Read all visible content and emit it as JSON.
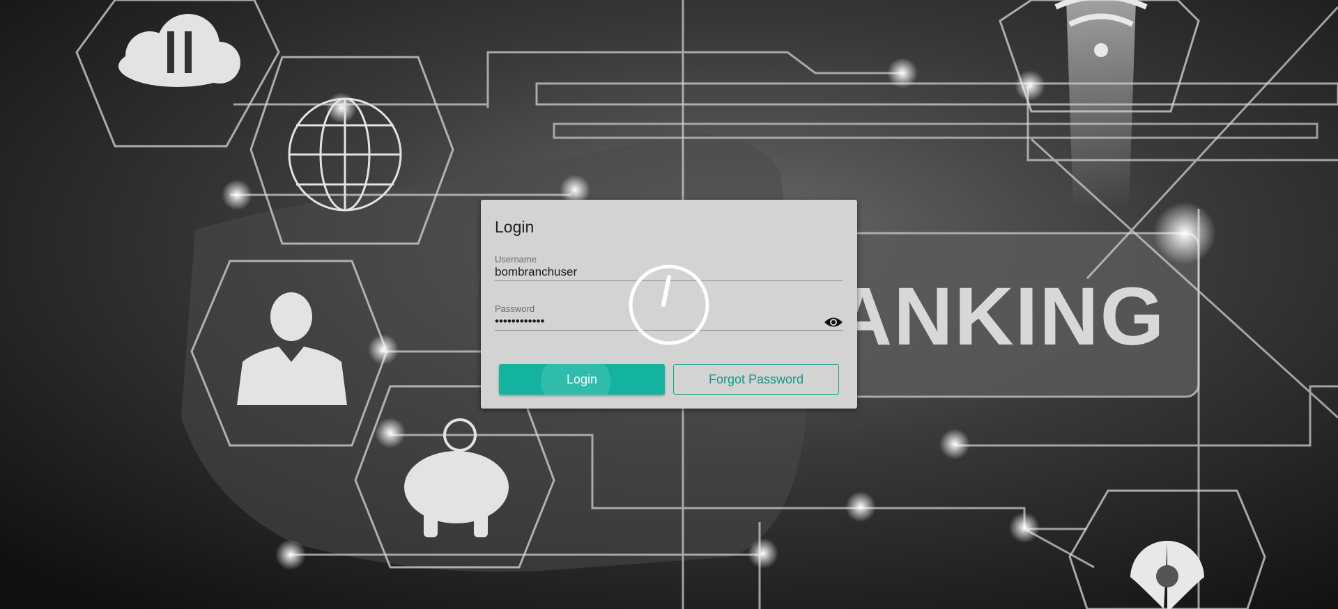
{
  "background": {
    "banner_text": "ANKING"
  },
  "login": {
    "title": "Login",
    "username_label": "Username",
    "username_value": "bombranchuser",
    "password_label": "Password",
    "password_value": "••••••••••••",
    "login_button": "Login",
    "forgot_button": "Forgot Password",
    "show_password_icon": "eye-icon"
  },
  "colors": {
    "accent": "#13b3a0",
    "card_bg": "#d3d3d3"
  },
  "loading": {
    "icon": "loading-spinner-icon"
  }
}
